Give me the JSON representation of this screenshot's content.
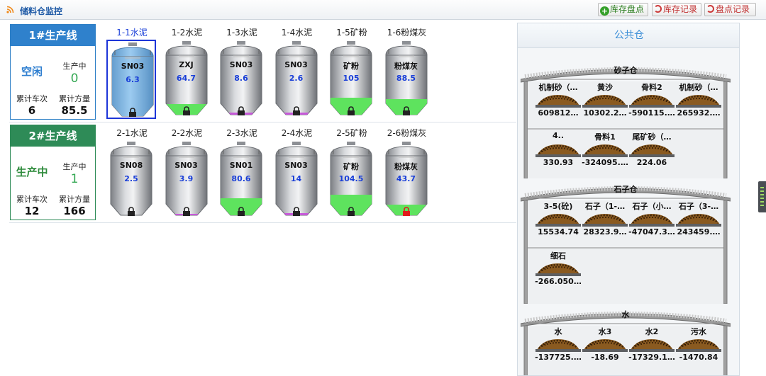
{
  "header": {
    "title": "储料仓监控"
  },
  "toolbar": {
    "stock_check": "库存盘点",
    "stock_record": "库存记录",
    "check_record": "盘点记录"
  },
  "lines": [
    {
      "name": "1#生产线",
      "status": "空闲",
      "producing_label": "生产中",
      "producing": "0",
      "trips_label": "累计车次",
      "trips": "6",
      "volume_label": "累计方量",
      "volume": "85.5"
    },
    {
      "name": "2#生产线",
      "status": "生产中",
      "producing_label": "生产中",
      "producing": "1",
      "trips_label": "累计车次",
      "trips": "12",
      "volume_label": "累计方量",
      "volume": "166"
    }
  ],
  "silos": [
    [
      {
        "label": "1-1水泥",
        "material": "SN03",
        "value": "6.3",
        "selected": true,
        "fill": 1.0,
        "fill_color": "#6fb0e6",
        "lock": "black"
      },
      {
        "label": "1-2水泥",
        "material": "ZXJ",
        "value": "64.7",
        "fill": 0.18,
        "fill_color": "#5ee35e",
        "lock": "black"
      },
      {
        "label": "1-3水泥",
        "material": "SN03",
        "value": "8.6",
        "fill": 0.03,
        "fill_color": "#c659d8",
        "lock": "black"
      },
      {
        "label": "1-4水泥",
        "material": "SN03",
        "value": "2.6",
        "fill": 0.03,
        "fill_color": "#c659d8",
        "lock": "black"
      },
      {
        "label": "1-5矿粉",
        "material": "矿粉",
        "value": "105",
        "fill": 0.28,
        "fill_color": "#5ee35e",
        "lock": "black"
      },
      {
        "label": "1-6粉煤灰",
        "material": "粉煤灰",
        "value": "88.5",
        "fill": 0.26,
        "fill_color": "#5ee35e",
        "lock": "black"
      }
    ],
    [
      {
        "label": "2-1水泥",
        "material": "SN08",
        "value": "2.5",
        "fill": 0.0,
        "fill_color": "#5ee35e",
        "lock": "black"
      },
      {
        "label": "2-2水泥",
        "material": "SN03",
        "value": "3.9",
        "fill": 0.02,
        "fill_color": "#c659d8",
        "lock": "black"
      },
      {
        "label": "2-3水泥",
        "material": "SN01",
        "value": "80.6",
        "fill": 0.28,
        "fill_color": "#5ee35e",
        "lock": "black"
      },
      {
        "label": "2-4水泥",
        "material": "SN03",
        "value": "14",
        "fill": 0.03,
        "fill_color": "#c659d8",
        "lock": "black"
      },
      {
        "label": "2-5矿粉",
        "material": "矿粉",
        "value": "104.5",
        "fill": 0.35,
        "fill_color": "#5ee35e",
        "lock": "black"
      },
      {
        "label": "2-6粉煤灰",
        "material": "粉煤灰",
        "value": "43.7",
        "fill": 0.18,
        "fill_color": "#5ee35e",
        "lock": "red"
      }
    ]
  ],
  "public": {
    "title": "公共仓",
    "sheds": [
      {
        "name": "砂子仓",
        "piles": [
          {
            "name": "机制砂（…",
            "value": "609812…"
          },
          {
            "name": "黄沙",
            "value": "10302.2…"
          },
          {
            "name": "骨料2",
            "value": "-590115.…"
          },
          {
            "name": "机制砂（…",
            "value": "265932.…"
          },
          {
            "name": "4..",
            "value": "330.93"
          },
          {
            "name": "骨料1",
            "value": "-324095.…"
          },
          {
            "name": "尾矿砂（…",
            "value": "224.06"
          }
        ]
      },
      {
        "name": "石子仓",
        "piles": [
          {
            "name": "3-5(砼)",
            "value": "15534.74"
          },
          {
            "name": "石子（1-…",
            "value": "28323.9…"
          },
          {
            "name": "石子（小…",
            "value": "-47047.3…"
          },
          {
            "name": "石子（3-…",
            "value": "243459.…"
          },
          {
            "name": "细石",
            "value": "-266.050…"
          }
        ]
      },
      {
        "name": "水",
        "piles": [
          {
            "name": "水",
            "value": "-137725.…"
          },
          {
            "name": "水3",
            "value": "-18.69"
          },
          {
            "name": "水2",
            "value": "-17329.1…"
          },
          {
            "name": "污水",
            "value": "-1470.84"
          }
        ]
      }
    ]
  }
}
